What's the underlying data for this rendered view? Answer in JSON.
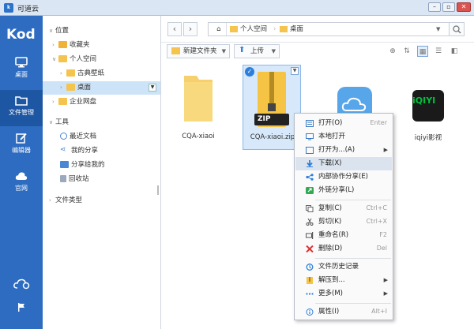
{
  "window": {
    "title": "可道云",
    "app_icon": "kod-app-icon"
  },
  "leftbar": {
    "logo": "Kod",
    "items": [
      {
        "label": "桌面",
        "icon": "monitor-icon"
      },
      {
        "label": "文件管理",
        "icon": "folder-icon"
      },
      {
        "label": "编辑器",
        "icon": "edit-icon"
      },
      {
        "label": "官网",
        "icon": "cloud-icon"
      }
    ]
  },
  "tree": {
    "position_label": "位置",
    "favorites": "收藏夹",
    "personal_space": "个人空间",
    "classic_wallpaper": "古典壁纸",
    "desktop": "桌面",
    "enterprise_disk": "企业网盘",
    "tools_label": "工具",
    "recent_docs": "最近文档",
    "my_share": "我的分享",
    "shared_with_me": "分享给我的",
    "recycle_bin": "回收站",
    "file_type": "文件类型"
  },
  "breadcrumb": {
    "items": [
      "个人空间",
      "桌面"
    ]
  },
  "toolbar": {
    "new_folder": "新建文件夹",
    "upload": "上传"
  },
  "files": [
    {
      "name": "CQA-xiaoi",
      "type": "folder"
    },
    {
      "name": "CQA-xiaoi.zip",
      "type": "zip",
      "thumb_text": "ZIP"
    },
    {
      "name": "",
      "type": "icloud"
    },
    {
      "name": "iqiyi影视",
      "type": "iqiyi",
      "thumb_text": "iQIYI"
    }
  ],
  "context_menu": {
    "items": [
      {
        "label": "打开(O)",
        "shortcut": "Enter",
        "icon": "open-icon"
      },
      {
        "label": "本地打开",
        "shortcut": "",
        "icon": "local-open-icon"
      },
      {
        "label": "打开为...(A)",
        "shortcut": "",
        "icon": "open-as-icon",
        "submenu": true
      },
      {
        "label": "下载(X)",
        "shortcut": "",
        "icon": "download-icon"
      },
      {
        "label": "内部协作分享(E)",
        "shortcut": "",
        "icon": "share-internal-icon"
      },
      {
        "label": "外链分享(L)",
        "shortcut": "",
        "icon": "external-link-share-icon"
      },
      {
        "label": "复制(C)",
        "shortcut": "Ctrl+C",
        "icon": "copy-icon"
      },
      {
        "label": "剪切(K)",
        "shortcut": "Ctrl+X",
        "icon": "cut-icon"
      },
      {
        "label": "重命名(R)",
        "shortcut": "F2",
        "icon": "rename-icon"
      },
      {
        "label": "删除(D)",
        "shortcut": "Del",
        "icon": "delete-icon"
      },
      {
        "label": "文件历史记录",
        "shortcut": "",
        "icon": "history-icon"
      },
      {
        "label": "解压到...",
        "shortcut": "",
        "icon": "extract-icon",
        "submenu": true
      },
      {
        "label": "更多(M)",
        "shortcut": "",
        "icon": "more-icon",
        "submenu": true
      },
      {
        "label": "属性(I)",
        "shortcut": "Alt+I",
        "icon": "properties-icon"
      }
    ]
  }
}
